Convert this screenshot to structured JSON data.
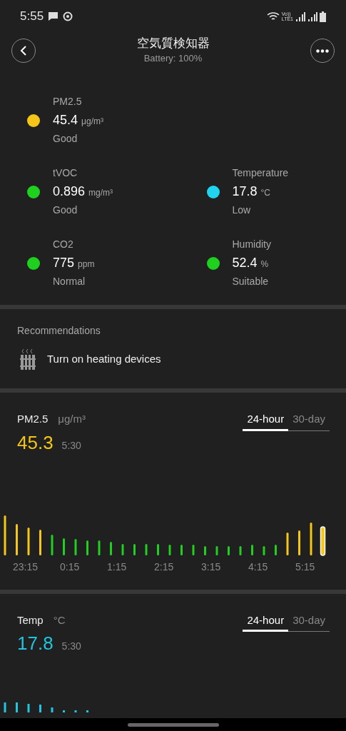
{
  "status_bar": {
    "time": "5:55",
    "volte": "Vo))",
    "network": "LTE1"
  },
  "header": {
    "title": "空気質検知器",
    "subtitle": "Battery: 100%"
  },
  "metric_rows": [
    {
      "items": [
        {
          "name": "PM2.5",
          "value": "45.4",
          "unit": "μg/m³",
          "status": "Good",
          "color": "#f5c518"
        }
      ]
    },
    {
      "items": [
        {
          "name": "tVOC",
          "value": "0.896",
          "unit": "mg/m³",
          "status": "Good",
          "color": "#1fd01f"
        },
        {
          "name": "Temperature",
          "value": "17.8",
          "unit": "°C",
          "status": "Low",
          "color": "#22d3f0"
        }
      ]
    },
    {
      "items": [
        {
          "name": "CO2",
          "value": "775",
          "unit": "ppm",
          "status": "Normal",
          "color": "#1fd01f"
        },
        {
          "name": "Humidity",
          "value": "52.4",
          "unit": "%",
          "status": "Suitable",
          "color": "#1fd01f"
        }
      ]
    }
  ],
  "recommendations": {
    "title": "Recommendations",
    "items": [
      "Turn on heating devices"
    ]
  },
  "charts": [
    {
      "kind": "pm",
      "title": "PM2.5",
      "unit": "μg/m³",
      "value": "45.3",
      "time": "5:30",
      "color": "#f5c518",
      "tabs": [
        {
          "label": "24-hour",
          "selected": true
        },
        {
          "label": "30-day",
          "selected": false
        }
      ],
      "x_labels": [
        "23:15",
        "0:15",
        "1:15",
        "2:15",
        "3:15",
        "4:15",
        "5:15"
      ]
    },
    {
      "kind": "temp",
      "title": "Temp",
      "unit": "°C",
      "value": "17.8",
      "time": "5:30",
      "color": "#22c5e0",
      "tabs": [
        {
          "label": "24-hour",
          "selected": true
        },
        {
          "label": "30-day",
          "selected": false
        }
      ]
    }
  ]
}
